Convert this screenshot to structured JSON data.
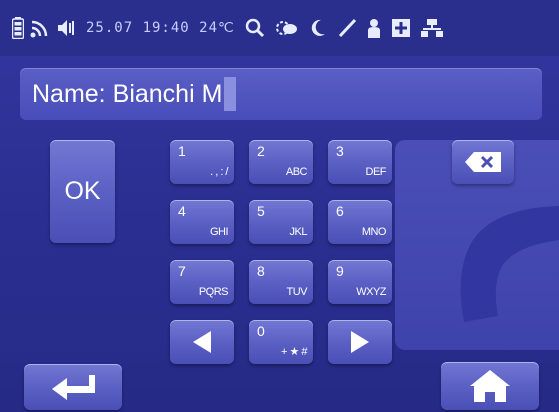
{
  "status_bar": {
    "text": "25.07 19:40 24℃",
    "icons_left": [
      "battery-icon",
      "wifi-icon",
      "speaker-icon"
    ],
    "icons_right": [
      "search-icon",
      "weather-icon",
      "moon-icon",
      "pen-icon",
      "person-icon",
      "plus-icon",
      "network-icon"
    ]
  },
  "name_field": {
    "label": "Name:",
    "value": "Bianchi M"
  },
  "ok_button": {
    "label": "OK"
  },
  "keypad": [
    {
      "digit": "1",
      "letters": ". , : /"
    },
    {
      "digit": "2",
      "letters": "ABC"
    },
    {
      "digit": "3",
      "letters": "DEF"
    },
    {
      "digit": "4",
      "letters": "GHI"
    },
    {
      "digit": "5",
      "letters": "JKL"
    },
    {
      "digit": "6",
      "letters": "MNO"
    },
    {
      "digit": "7",
      "letters": "PQRS"
    },
    {
      "digit": "8",
      "letters": "TUV"
    },
    {
      "digit": "9",
      "letters": "WXYZ"
    },
    {
      "digit": "0",
      "letters": "+ ★ #"
    }
  ],
  "colors": {
    "background": "#2a2e90",
    "button": "#5b60c4",
    "field": "#4f54bf",
    "text": "#ffffff"
  }
}
